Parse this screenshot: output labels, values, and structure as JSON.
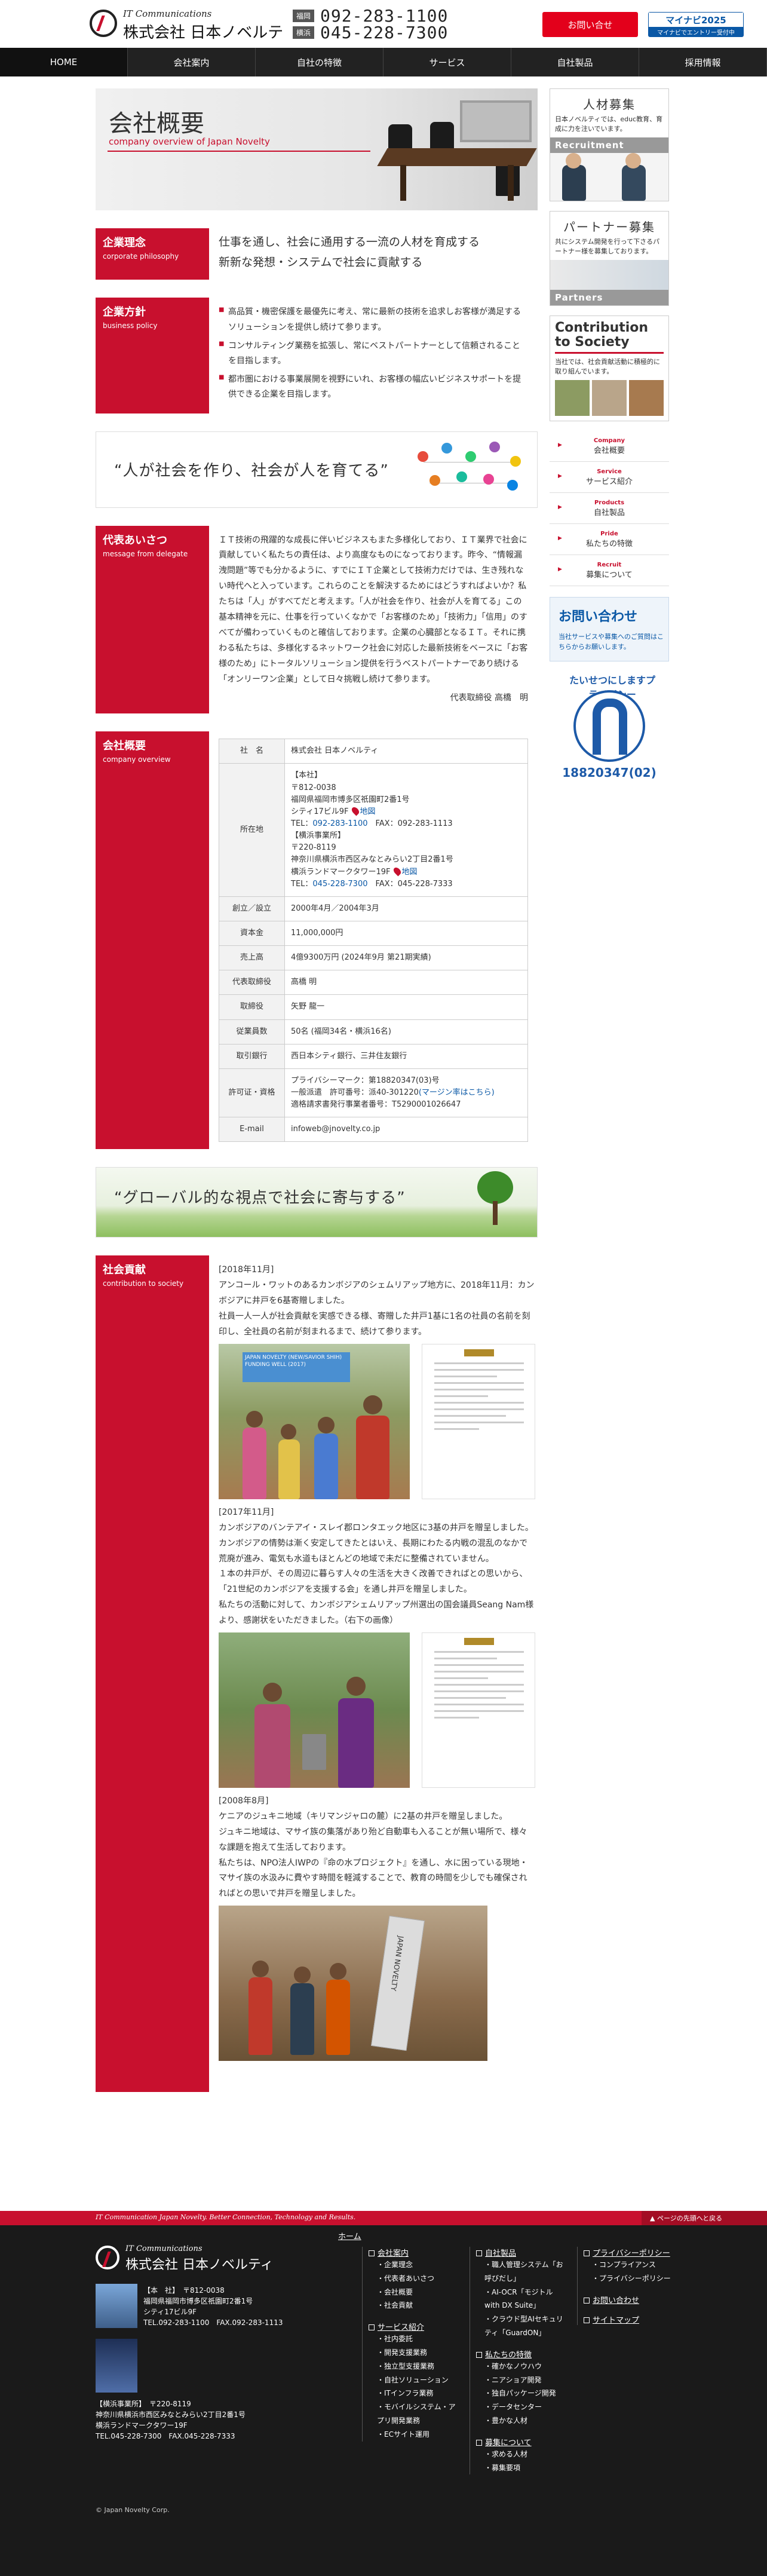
{
  "header": {
    "logo_sub": "IT Communications",
    "logo_name": "株式会社 日本ノベルティ",
    "tel_label": "福岡",
    "tel": "092-283-1100",
    "tel2_label": "横浜",
    "tel2": "045-228-7300",
    "contact": "お問い合せ",
    "mynavi_top": "マイナビ2025",
    "mynavi_bottom": "マイナビでエントリー受付中"
  },
  "nav": [
    "HOME",
    "会社案内",
    "自社の特徴",
    "サービス",
    "自社製品",
    "採用情報"
  ],
  "hero": {
    "title": "会社概要",
    "subtitle": "company overview of Japan Novelty"
  },
  "philosophy": {
    "jp": "企業理念",
    "en": "corporate philosophy",
    "lines": [
      "仕事を通し、社会に通用する一流の人材を育成する",
      "新新な発想・システムで社会に貢献する"
    ]
  },
  "policy": {
    "jp": "企業方針",
    "en": "business policy",
    "items": [
      "高品質・機密保護を最優先に考え、常に最新の技術を追求しお客様が満足するソリューションを提供し続けて参ります。",
      "コンサルティング業務を拡張し、常にベストパートナーとして信頼されることを目指します。",
      "都市圏における事業展開を視野にいれ、お客様の幅広いビジネスサポートを提供できる企業を目指します。"
    ]
  },
  "quote1": "“人が社会を作り、社会が人を育てる”",
  "greeting": {
    "jp": "代表あいさつ",
    "en": "message from delegate",
    "body": "ＩＴ技術の飛躍的な成長に伴いビジネスもまた多様化しており、ＩＴ業界で社会に貢献していく私たちの責任は、より高度なものになっております。昨今、“情報漏洩問題”等でも分かるように、すでにＩＴ企業として技術力だけでは、生き残れない時代へと入っています。これらのことを解決するためにはどうすればよいか？私たちは「人」がすべてだと考えます。「人が社会を作り、社会が人を育てる」この基本精神を元に、仕事を行っていくなかで「お客様のため」「技術力」「信用」のすべてが備わっていくものと確信しております。企業の心臓部となるＩＴ。それに携わる私たちは、多様化するネットワーク社会に対応した最新技術をベースに「お客様のため」にトータルソリューション提供を行うベストパートナーであり続ける「オンリーワン企業」として日々挑戦し続けて参ります。",
    "sign": "代表取締役 高橋　明"
  },
  "overview": {
    "jp": "会社概要",
    "en": "company overview",
    "rows": [
      {
        "k": "社　名",
        "v": "株式会社 日本ノベルティ"
      },
      {
        "k": "所在地",
        "v": "【本社】\n〒812-0038\n福岡県福岡市博多区祇園町2番1号\nシティ17ビル9F",
        "map": "地図",
        "tel_a": "TEL：",
        "tel": "092-283-1100",
        "fax": "　FAX：092-283-1113",
        "v2": "【横浜事業所】\n〒220-8119\n神奈川県横浜市西区みなとみらい2丁目2番1号\n横浜ランドマークタワー19F",
        "map2": "地図",
        "tel2": "045-228-7300",
        "fax2": "　FAX：045-228-7333"
      },
      {
        "k": "創立／設立",
        "v": "2000年4月／2004年3月"
      },
      {
        "k": "資本金",
        "v": "11,000,000円"
      },
      {
        "k": "売上高",
        "v": "4億9300万円 (2024年9月 第21期実績)"
      },
      {
        "k": "代表取締役",
        "v": "高橋 明"
      },
      {
        "k": "取締役",
        "v": "矢野 龍一"
      },
      {
        "k": "従業員数",
        "v": "50名 (福岡34名・横浜16名)"
      },
      {
        "k": "取引銀行",
        "v": "西日本シティ銀行、三井住友銀行"
      },
      {
        "k": "許可证・資格",
        "v": "プライバシーマーク：第18820347(03)号\n一般派遣　許可番号：派40-301220",
        "link": "(マージン率はこちら)",
        "v2": "\n適格請求書発行事業者番号：T5290001026647"
      },
      {
        "k": "E-mail",
        "v": "infoweb@jnovelty.co.jp"
      }
    ]
  },
  "quote2": "“グローバル的な視点で社会に寄与する”",
  "csr": {
    "jp": "社会貢献",
    "en": "contribution to society",
    "p1_date": "[2018年11月]",
    "p1": "アンコール・ワットのあるカンボジアのシェムリアップ地方に、2018年11月：カンボジアに井戸を6基寄贈しました。\n社員一人一人が社会貢献を実感できる様、寄贈した井戸1基に1名の社員の名前を刻印し、全社員の名前が刻まれるまで、続けて参ります。",
    "p2_date": "[2017年11月]",
    "p2": "カンボジアのバンテアイ・スレイ郡ロンタエック地区に3基の井戸を贈呈しました。\nカンボジアの情勢は漸く安定してきたとはいえ、長期にわたる内戦の混乱のなかで荒廃が進み、電気も水道もほとんどの地域で未だに整備されていません。\n１本の井戸が、その周辺に暮らす人々の生活を大きく改善できればとの思いから、「21世紀のカンボジアを支援する会」を通し井戸を贈呈しました。\n私たちの活動に対して、カンボジアシェムリアップ州選出の国会議員Seang Nam様より、感謝状をいただきました。（右下の画像）",
    "p3_date": "[2008年8月]",
    "p3": "ケニアのジュキニ地域（キリマンジャロの麓）に2基の井戸を贈呈しました。\nジュキニ地域は、マサイ族の集落があり殆ど自動車も入ることが無い場所で、様々な課題を抱えて生活しております。\n私たちは、NPO法人IWPの『命の水プロジェクト』を通し、水に困っている現地・マサイ族の水汲みに費やす時間を軽減することで、教育の時間を少しでも確保されればとの思いで井戸を贈呈しました。",
    "banner_text": "JAPAN NOVELTY (NEW/SAVIOR SHIH) FUNDING WELL (2017)",
    "pump_text": "JAPAN NOVELTY"
  },
  "side": {
    "recruit_title": "人材募集",
    "recruit_text": "日本ノベルティでは、educ教育、育成に力を注いでいます。",
    "recruit_strip": "Recruitment",
    "partner_title": "パートナー募集",
    "partner_text": "共にシステム開発を行って下さるパートナー様を募集しております。",
    "partner_strip": "Partners",
    "csr_title": "Contribution to Society",
    "csr_text": "当社では、社会貢献活動に積極的に取り組んでいます。",
    "menu": [
      {
        "en": "Company",
        "jp": "会社概要"
      },
      {
        "en": "Service",
        "jp": "サービス紹介"
      },
      {
        "en": "Products",
        "jp": "自社製品"
      },
      {
        "en": "Pride",
        "jp": "私たちの特徴"
      },
      {
        "en": "Recruit",
        "jp": "募集について"
      }
    ],
    "inquiry_title": "お問い合わせ",
    "inquiry_text": "当社サービスや募集へのご質問はこちらからお願いします。",
    "pmark_arc": "たいせつにしますプライバシー",
    "pmark_num": "18820347(02)"
  },
  "footer": {
    "bar_left": "IT Communication Japan Novelty. Better Connection, Technology and Results.",
    "bar_right": "▲ ページの先頭へと戻る",
    "logo_sub": "IT Communications",
    "logo_name": "株式会社 日本ノベルティ",
    "hq": "【本　社】　〒812-0038\n福岡県福岡市博多区祇園町2番1号\nシティ17ビル9F\nTEL.092-283-1100　FAX.092-283-1113",
    "yk": "【横浜事業所】　〒220-8119\n神奈川県横浜市西区みなとみらい2丁目2番1号\n横浜ランドマークタワー19F\nTEL.045-228-7300　FAX.045-228-7333",
    "copyright": "© Japan Novelty Corp.",
    "home": "ホーム",
    "col1_head": "会社案内",
    "col1": [
      "企業理念",
      "代表者あいさつ",
      "会社概要",
      "社会貢献"
    ],
    "col1b_head": "サービス紹介",
    "col1b": [
      "社内委託",
      "開発支援業務",
      "独立型支援業務",
      "自社ソリューション",
      "ITインフラ業務",
      "モバイルシステム・アプリ開発業務",
      "ECサイト運用"
    ],
    "col2_head": "自社製品",
    "col2": [
      "職人管理システム「お呼びだし」",
      "AI-OCR「モジトル with DX Suite」",
      "クラウド型AIセキュリティ「GuardON」"
    ],
    "col2b_head": "私たちの特徴",
    "col2b": [
      "確かなノウハウ",
      "ニアショア開発",
      "独自パッケージ開発",
      "データセンター",
      "豊かな人材"
    ],
    "col2c_head": "募集について",
    "col2c": [
      "求める人材",
      "募集要項"
    ],
    "col3_head": "プライバシーポリシー",
    "col3": [
      "コンプライアンス",
      "プライバシーポリシー"
    ],
    "col3b": "お問い合わせ",
    "col3c": "サイトマップ"
  }
}
